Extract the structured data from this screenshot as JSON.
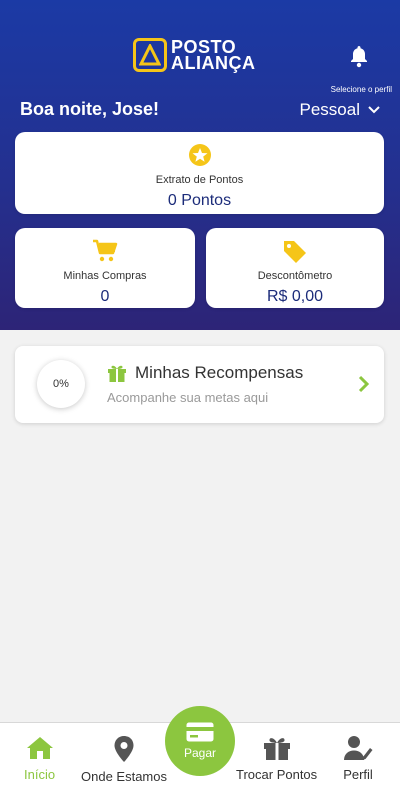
{
  "brand": {
    "line1": "POSTO",
    "line2": "ALIANÇA"
  },
  "header": {
    "greeting": "Boa noite, Jose!",
    "profile_hint": "Selecione o perfil",
    "profile_value": "Pessoal"
  },
  "cards": {
    "extrato": {
      "label": "Extrato de Pontos",
      "value": "0 Pontos",
      "icon": "star-icon"
    },
    "compras": {
      "label": "Minhas Compras",
      "value": "0",
      "icon": "cart-icon"
    },
    "desconto": {
      "label": "Descontômetro",
      "value": "R$ 0,00",
      "icon": "price-tag-icon"
    }
  },
  "rewards": {
    "progress": "0%",
    "title": "Minhas Recompensas",
    "subtitle": "Acompanhe sua metas aqui"
  },
  "tabbar": {
    "inicio": "Início",
    "onde": "Onde Estamos",
    "pagar": "Pagar",
    "trocar": "Trocar Pontos",
    "perfil": "Perfil"
  },
  "colors": {
    "header_top": "#1b3aa5",
    "header_bottom": "#2d2477",
    "accent_green": "#8cc63f",
    "accent_yellow": "#f5c518",
    "value_blue": "#1c2c7a"
  }
}
